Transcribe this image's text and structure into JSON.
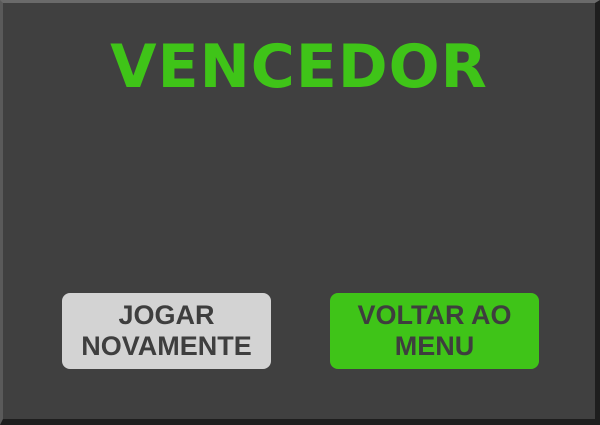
{
  "screen": {
    "title": "VENCEDOR"
  },
  "buttons": {
    "play_again_label": "JOGAR NOVAMENTE",
    "back_to_menu_label": "VOLTAR AO MENU"
  },
  "colors": {
    "background": "#404040",
    "accent_green": "#3fc418",
    "button_gray": "#d3d3d3",
    "button_text": "#3e3e3e"
  }
}
